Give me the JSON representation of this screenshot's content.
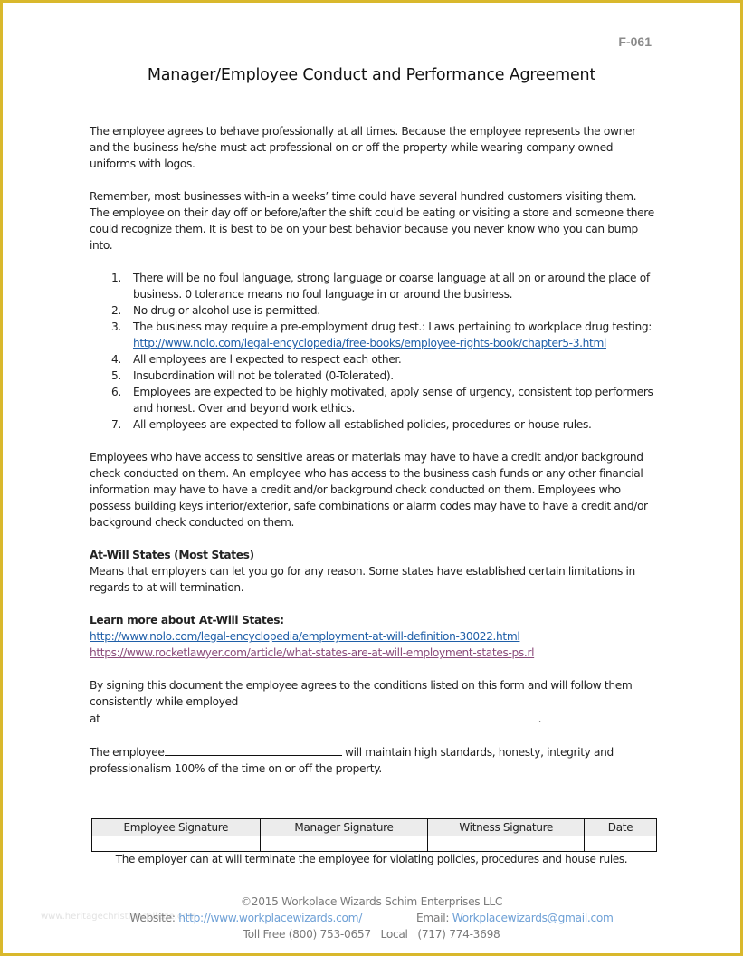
{
  "form_code": "F-061",
  "title": "Manager/Employee Conduct and Performance Agreement",
  "paragraphs": {
    "intro": "The employee agrees to behave professionally at all times. Because the employee represents the owner and the business he/she must act professional on or off the property while wearing company owned uniforms with logos.",
    "remember": "Remember, most businesses with-in a weeks’ time could have several hundred customers visiting them. The employee on their day off or before/after the shift could be eating or visiting a store and someone there could recognize them. It is best to be on your best behavior because you never know who you can bump into.",
    "background": "Employees who have access to sensitive areas or materials may have to have a credit and/or background check conducted on them. An employee who has access to the business cash funds or any other financial information may have to have a credit and/or background check conducted on them. Employees who possess building keys interior/exterior, safe combinations or alarm codes may have to have a credit and/or background check conducted on them."
  },
  "rules": [
    {
      "num": "1.",
      "text": "There will be no foul language, strong language or coarse language at all on or around the place of business. 0 tolerance means no foul language in or around the business."
    },
    {
      "num": "2.",
      "text": "No drug or alcohol use is permitted."
    },
    {
      "num": "3.",
      "text": "The business may require a pre-employment drug test.:  Laws pertaining to workplace drug testing:  ",
      "link": "http://www.nolo.com/legal-encyclopedia/free-books/employee-rights-book/chapter5-3.html"
    },
    {
      "num": "4.",
      "text": "All employees are l expected to respect each other."
    },
    {
      "num": "5.",
      "text": "Insubordination will not be tolerated (0-Tolerated)."
    },
    {
      "num": "6.",
      "text": "Employees are expected to be highly motivated, apply sense of urgency, consistent top performers and honest. Over and beyond work ethics."
    },
    {
      "num": "7.",
      "text": "All employees are expected to follow all established policies, procedures or house rules."
    }
  ],
  "at_will": {
    "heading": "At-Will States (Most States)",
    "text": "Means that employers can let you go for any reason. Some states have established certain limitations in regards to at will termination.",
    "learn_more": "Learn more about At-Will States:",
    "link1": "http://www.nolo.com/legal-encyclopedia/employment-at-will-definition-30022.html",
    "link2": "https://www.rocketlawyer.com/article/what-states-are-at-will-employment-states-ps.rl"
  },
  "signing": {
    "text": "By signing this document the employee agrees to the conditions listed on this form and will follow them consistently while employed",
    "at_prefix": "at",
    "at_suffix": ".",
    "at_value": "",
    "employee_prefix": "The employee",
    "employee_value": "",
    "employee_suffix": " will maintain high standards, honesty, integrity and professionalism 100% of the time on or off the property."
  },
  "signature_table": {
    "headers": [
      "Employee Signature",
      "Manager Signature",
      "Witness Signature",
      "Date"
    ],
    "values": [
      "",
      "",
      "",
      ""
    ]
  },
  "termination_note": "The employer can at will terminate the employee for violating policies, procedures and house rules.",
  "footer": {
    "copyright": "©2015 Workplace Wizards Schim Enterprises LLC",
    "website_label": "Website: ",
    "website": "http://www.workplacewizards.com/",
    "email_label": "Email: ",
    "email": "Workplacewizards@gmail.com",
    "phones": "Toll Free (800) 753-0657   Local   (717) 774-3698"
  },
  "watermark": "www.heritagechristiancollege.com",
  "colors": {
    "border": "#d9b82c",
    "link": "#1f5fa8",
    "visited_link": "#8a4a7a",
    "footer_link": "#6ea0d6"
  }
}
